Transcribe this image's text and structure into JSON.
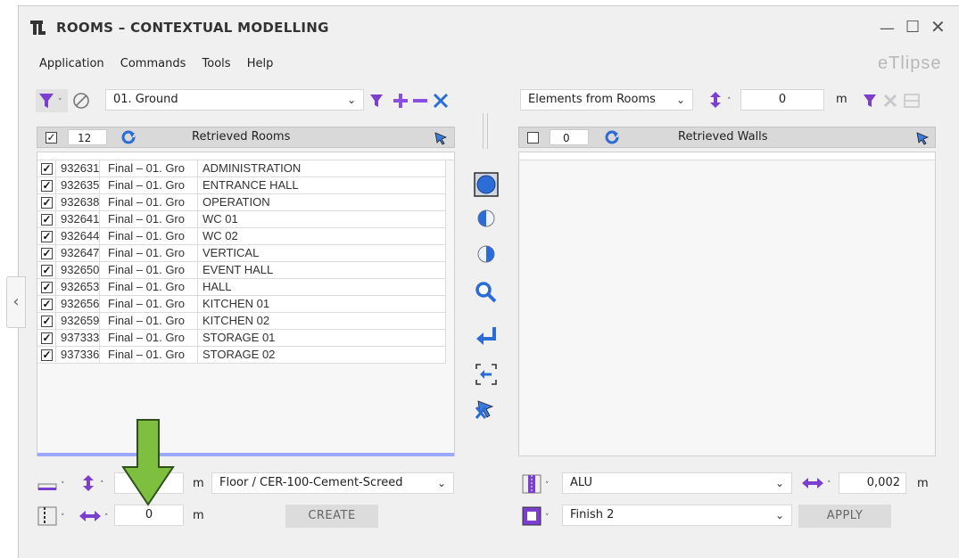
{
  "window": {
    "title": "ROOMS – CONTEXTUAL MODELLING",
    "brand": "eTlipse",
    "controls": {
      "minimize": "—",
      "maximize": "☐",
      "close": "✕"
    }
  },
  "menu": [
    "Application",
    "Commands",
    "Tools",
    "Help"
  ],
  "left_panel": {
    "level_select": "01. Ground",
    "header": {
      "count": "12",
      "title": "Retrieved Rooms"
    },
    "rows": [
      {
        "id": "932631",
        "level": "Final – 01. Gro",
        "name": "ADMINISTRATION"
      },
      {
        "id": "932635",
        "level": "Final – 01. Gro",
        "name": "ENTRANCE HALL"
      },
      {
        "id": "932638",
        "level": "Final – 01. Gro",
        "name": "OPERATION"
      },
      {
        "id": "932641",
        "level": "Final – 01. Gro",
        "name": "WC 01"
      },
      {
        "id": "932644",
        "level": "Final – 01. Gro",
        "name": "WC 02"
      },
      {
        "id": "932647",
        "level": "Final – 01. Gro",
        "name": "VERTICAL"
      },
      {
        "id": "932650",
        "level": "Final – 01. Gro",
        "name": "EVENT HALL"
      },
      {
        "id": "932653",
        "level": "Final – 01. Gro",
        "name": "HALL"
      },
      {
        "id": "932656",
        "level": "Final – 01. Gro",
        "name": "KITCHEN 01"
      },
      {
        "id": "932659",
        "level": "Final – 01. Gro",
        "name": "KITCHEN 02"
      },
      {
        "id": "937333",
        "level": "Final – 01. Gro",
        "name": "STORAGE 01"
      },
      {
        "id": "937336",
        "level": "Final – 01. Gro",
        "name": "STORAGE 02"
      }
    ],
    "bottom": {
      "height_unit": "m",
      "floor_type": "Floor / CER-100-Cement-Screed",
      "offset_value": "0",
      "offset_unit": "m",
      "create_label": "CREATE"
    }
  },
  "right_panel": {
    "source_select": "Elements from Rooms",
    "offset_value": "0",
    "offset_unit": "m",
    "header": {
      "count": "0",
      "title": "Retrieved Walls"
    },
    "bottom": {
      "material": "ALU",
      "thickness_value": "0,002",
      "thickness_unit": "m",
      "finish": "Finish 2",
      "apply_label": "APPLY"
    }
  },
  "colors": {
    "accent_blue": "#2b6cd6",
    "filter_purple": "#7b3fd0",
    "plus_purple": "#8a4fe0",
    "green_arrow": "#7fbf3f",
    "progress_bar": "#9aa9ff"
  }
}
